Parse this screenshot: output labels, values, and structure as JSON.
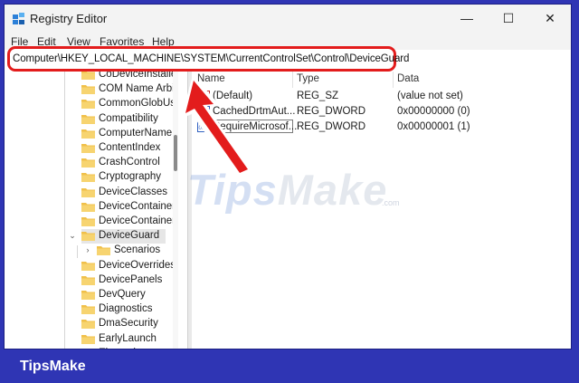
{
  "window": {
    "title": "Registry Editor",
    "minimize_glyph": "—",
    "maximize_glyph": "☐",
    "close_glyph": "✕"
  },
  "menu": [
    "File",
    "Edit",
    "View",
    "Favorites",
    "Help"
  ],
  "address_bar": {
    "path": "Computer\\HKEY_LOCAL_MACHINE\\SYSTEM\\CurrentControlSet\\Control\\DeviceGuard"
  },
  "tree": {
    "items": [
      {
        "label": "CoDeviceInstalle",
        "indent": 1
      },
      {
        "label": "COM Name Arbi",
        "indent": 1
      },
      {
        "label": "CommonGlobUs",
        "indent": 1
      },
      {
        "label": "Compatibility",
        "indent": 1
      },
      {
        "label": "ComputerName",
        "indent": 1
      },
      {
        "label": "ContentIndex",
        "indent": 1
      },
      {
        "label": "CrashControl",
        "indent": 1
      },
      {
        "label": "Cryptography",
        "indent": 1
      },
      {
        "label": "DeviceClasses",
        "indent": 1
      },
      {
        "label": "DeviceContainer",
        "indent": 1
      },
      {
        "label": "DeviceContainer",
        "indent": 1
      },
      {
        "label": "DeviceGuard",
        "indent": 1,
        "expanded": true,
        "selected": true
      },
      {
        "label": "Scenarios",
        "indent": 2
      },
      {
        "label": "DeviceOverrides",
        "indent": 1
      },
      {
        "label": "DevicePanels",
        "indent": 1
      },
      {
        "label": "DevQuery",
        "indent": 1
      },
      {
        "label": "Diagnostics",
        "indent": 1
      },
      {
        "label": "DmaSecurity",
        "indent": 1
      },
      {
        "label": "EarlyLaunch",
        "indent": 1
      },
      {
        "label": "Elantech",
        "indent": 1
      }
    ]
  },
  "values_list": {
    "columns": {
      "name": "Name",
      "type": "Type",
      "data": "Data"
    },
    "rows": [
      {
        "name": "(Default)",
        "type": "REG_SZ",
        "data": "(value not set)",
        "icon": "string-value-icon"
      },
      {
        "name": "CachedDrtmAut...",
        "type": "REG_DWORD",
        "data": "0x00000000 (0)",
        "icon": "binary-value-icon"
      },
      {
        "name": "RequireMicrosof...",
        "type": "REG_DWORD",
        "data": "0x00000001 (1)",
        "icon": "binary-value-icon",
        "editing": true
      }
    ]
  },
  "watermark": {
    "part1": "Tips",
    "part2": "Make",
    "suffix": ".com"
  },
  "footer": {
    "brand": "TipsMake"
  },
  "colors": {
    "highlight": "#e31c1c",
    "footer_bg": "#2f35b4",
    "folder": "#f0c04a"
  }
}
